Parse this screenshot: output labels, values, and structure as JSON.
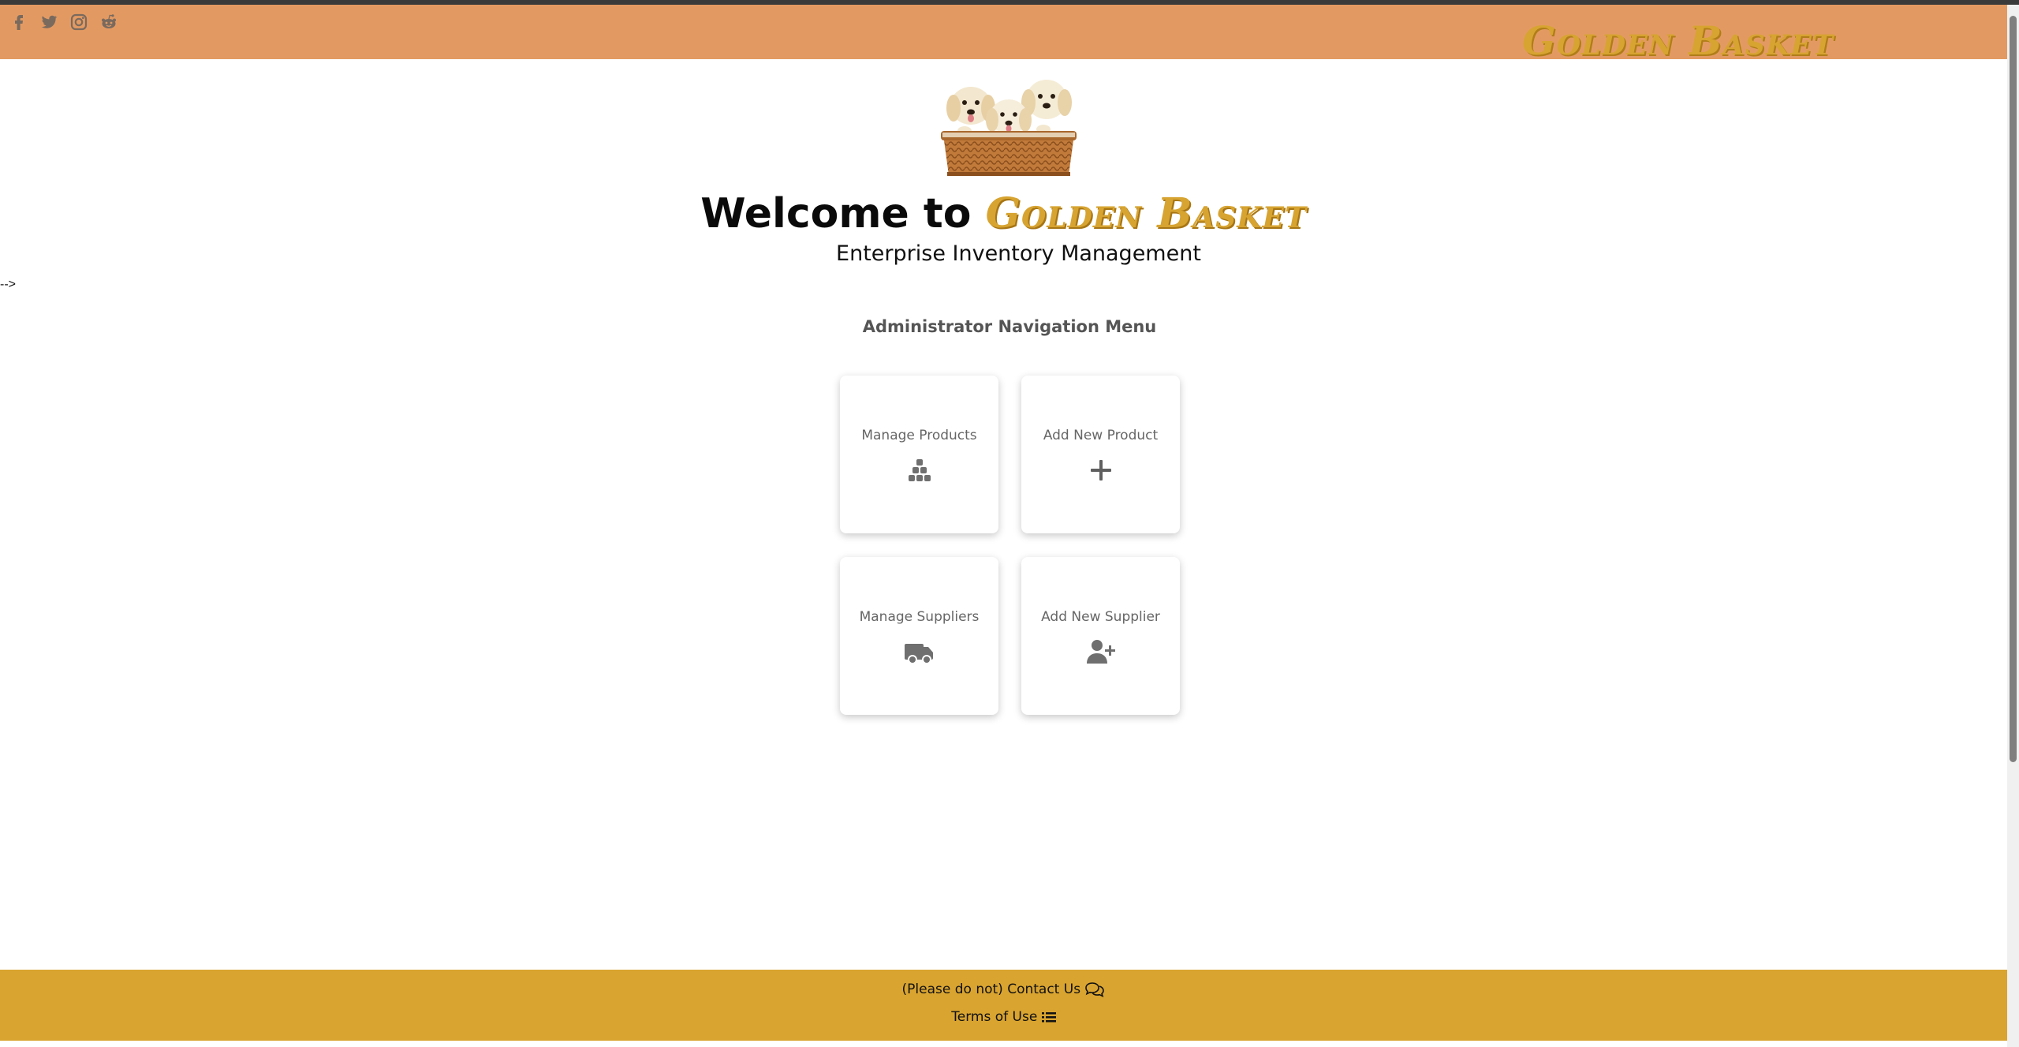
{
  "header": {
    "brand": "Golden Basket",
    "social_icons": [
      "facebook-icon",
      "twitter-icon",
      "instagram-icon",
      "reddit-icon"
    ]
  },
  "hero": {
    "welcome_prefix": "Welcome to",
    "brand": "Golden Basket",
    "subtitle": "Enterprise Inventory Management"
  },
  "stray_text": "-->",
  "menu": {
    "title": "Administrator Navigation Menu",
    "cards": [
      {
        "label": "Manage Products",
        "icon": "boxes-icon"
      },
      {
        "label": "Add New Product",
        "icon": "plus-icon"
      },
      {
        "label": "Manage Suppliers",
        "icon": "truck-icon"
      },
      {
        "label": "Add New Supplier",
        "icon": "user-plus-icon"
      }
    ]
  },
  "footer": {
    "contact": "(Please do not) Contact Us",
    "terms": "Terms of Use"
  },
  "colors": {
    "header_bg": "#e39a62",
    "brand_gold": "#d7a431",
    "footer_bg": "#d9a430"
  }
}
